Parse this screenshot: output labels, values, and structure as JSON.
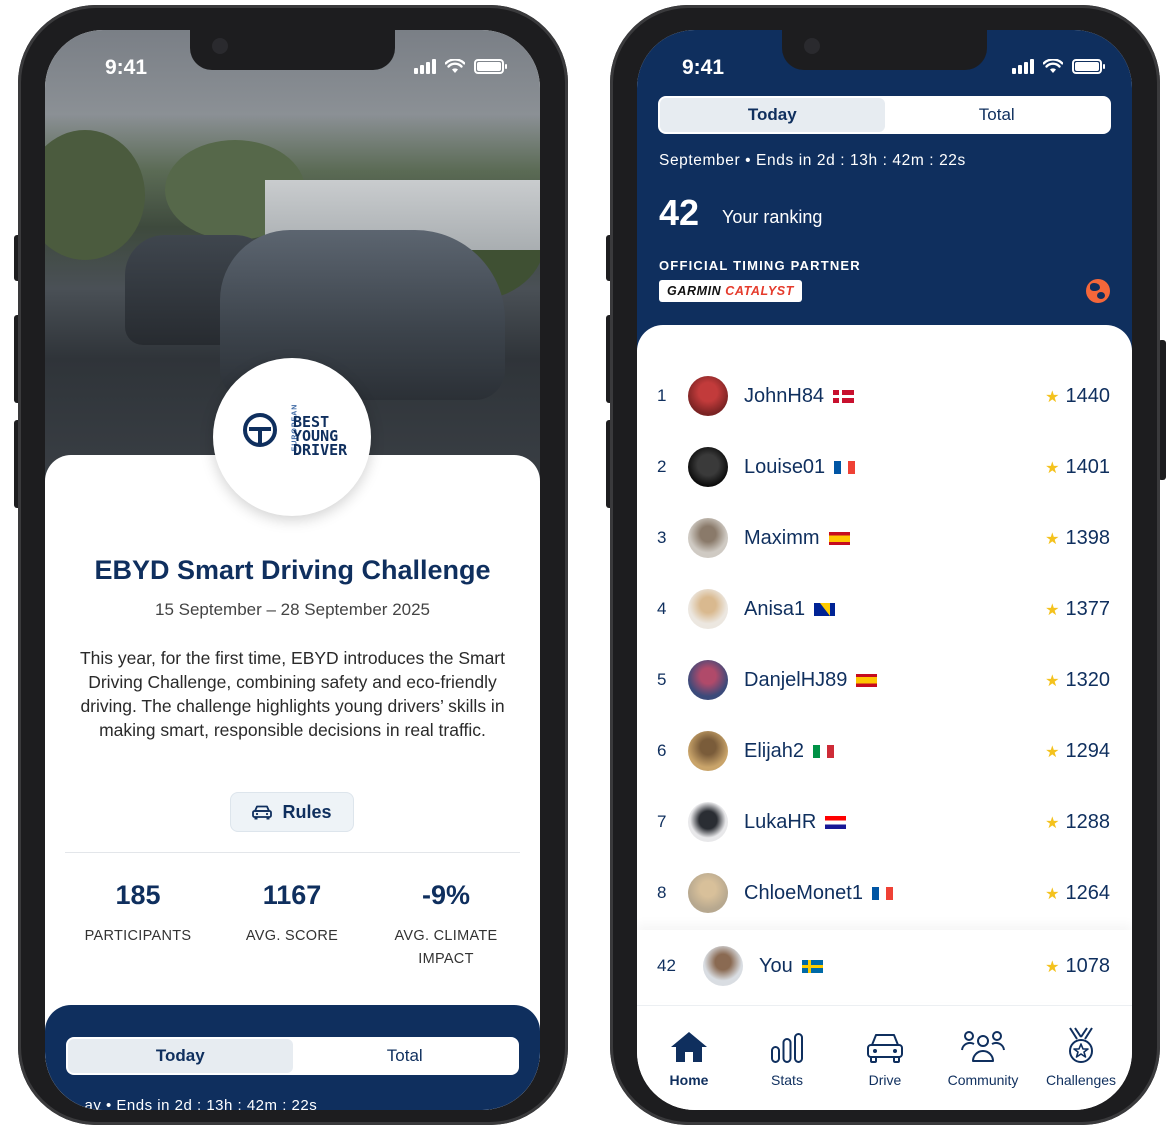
{
  "left_screen": {
    "status": {
      "time": "9:41"
    },
    "logo": {
      "side_text": "EUROPEAN",
      "lines": [
        "BEST",
        "YOUNG",
        "DRIVER"
      ]
    },
    "title": "EBYD Smart Driving Challenge",
    "dates": "15 September – 28 September 2025",
    "description": "This year, for the first time, EBYD introduces the Smart Driving Challenge, combining safety and eco-friendly driving. The challenge highlights young drivers’ skills in making smart, responsible decisions in real traffic.",
    "rules_label": "Rules",
    "stats": [
      {
        "value": "185",
        "label": "PARTICIPANTS"
      },
      {
        "value": "1167",
        "label": "AVG. SCORE"
      },
      {
        "value": "-9%",
        "label": "AVG. CLIMATE IMPACT"
      }
    ],
    "segmented": {
      "today": "Today",
      "total": "Total",
      "selected": "Today"
    },
    "peek_text": "…ay  •  Ends in 2d : 13h : 42m : 22s"
  },
  "right_screen": {
    "status": {
      "time": "9:41"
    },
    "segmented": {
      "today": "Today",
      "total": "Total",
      "selected": "Today"
    },
    "period": "September  •  Ends in 2d : 13h : 42m : 22s",
    "ranking": {
      "value": "42",
      "label": "Your ranking"
    },
    "partner": {
      "label": "OFFICIAL TIMING PARTNER",
      "brand": "GARMIN",
      "product": "CATALYST"
    },
    "leaderboard": [
      {
        "pos": "1",
        "name": "JohnH84",
        "flag": "denmark",
        "score": "1440"
      },
      {
        "pos": "2",
        "name": "Louise01",
        "flag": "france",
        "score": "1401"
      },
      {
        "pos": "3",
        "name": "Maximm",
        "flag": "spain",
        "score": "1398"
      },
      {
        "pos": "4",
        "name": "Anisa1",
        "flag": "bosnia",
        "score": "1377"
      },
      {
        "pos": "5",
        "name": "DanjelHJ89",
        "flag": "spain",
        "score": "1320"
      },
      {
        "pos": "6",
        "name": "Elijah2",
        "flag": "italy",
        "score": "1294"
      },
      {
        "pos": "7",
        "name": "LukaHR",
        "flag": "croatia",
        "score": "1288"
      },
      {
        "pos": "8",
        "name": "ChloeMonet1",
        "flag": "france",
        "score": "1264"
      }
    ],
    "you": {
      "pos": "42",
      "name": "You",
      "flag": "sweden",
      "score": "1078"
    },
    "tabs": [
      {
        "label": "Home",
        "icon": "home-icon",
        "active": true
      },
      {
        "label": "Stats",
        "icon": "stats-icon",
        "active": false
      },
      {
        "label": "Drive",
        "icon": "car-icon",
        "active": false
      },
      {
        "label": "Community",
        "icon": "community-icon",
        "active": false
      },
      {
        "label": "Challenges",
        "icon": "medal-icon",
        "active": false
      }
    ]
  },
  "colors": {
    "navy": "#0f2f5e",
    "star": "#f4c21d",
    "accent": "#f4673a"
  }
}
